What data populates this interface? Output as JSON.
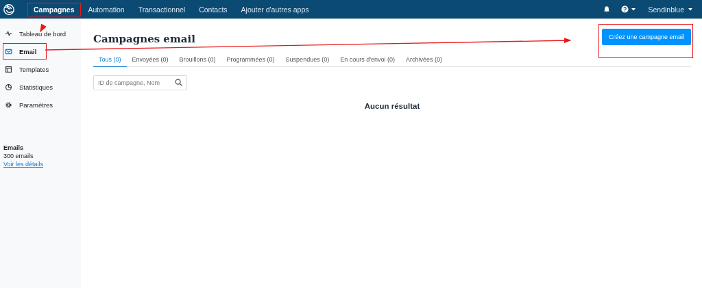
{
  "top_nav": {
    "items": [
      {
        "label": "Campagnes",
        "selected": true,
        "highlighted": true
      },
      {
        "label": "Automation",
        "selected": false,
        "highlighted": false
      },
      {
        "label": "Transactionnel",
        "selected": false,
        "highlighted": false
      },
      {
        "label": "Contacts",
        "selected": false,
        "highlighted": false
      },
      {
        "label": "Ajouter d'autres apps",
        "selected": false,
        "highlighted": false
      }
    ],
    "account": "Sendinblue"
  },
  "sidebar": {
    "items": [
      {
        "label": "Tableau de bord",
        "selected": false,
        "highlighted": false
      },
      {
        "label": "Email",
        "selected": true,
        "highlighted": true
      },
      {
        "label": "Templates",
        "selected": false,
        "highlighted": false
      },
      {
        "label": "Statistiques",
        "selected": false,
        "highlighted": false
      },
      {
        "label": "Paramètres",
        "selected": false,
        "highlighted": false
      }
    ],
    "quota": {
      "title": "Emails",
      "count": "300 emails",
      "link": "Voir les détails"
    }
  },
  "page": {
    "title": "Campagnes email",
    "create_button": {
      "label": "Créez une campagne email",
      "highlighted": true
    },
    "tabs": [
      {
        "label": "Tous (0)",
        "selected": true
      },
      {
        "label": "Envoyées (0)",
        "selected": false
      },
      {
        "label": "Brouillons (0)",
        "selected": false
      },
      {
        "label": "Programmées (0)",
        "selected": false
      },
      {
        "label": "Suspendues (0)",
        "selected": false
      },
      {
        "label": "En cours d'envoi (0)",
        "selected": false
      },
      {
        "label": "Archivées (0)",
        "selected": false
      }
    ],
    "search": {
      "placeholder": "ID de campagne, Nom"
    },
    "empty_message": "Aucun résultat"
  }
}
